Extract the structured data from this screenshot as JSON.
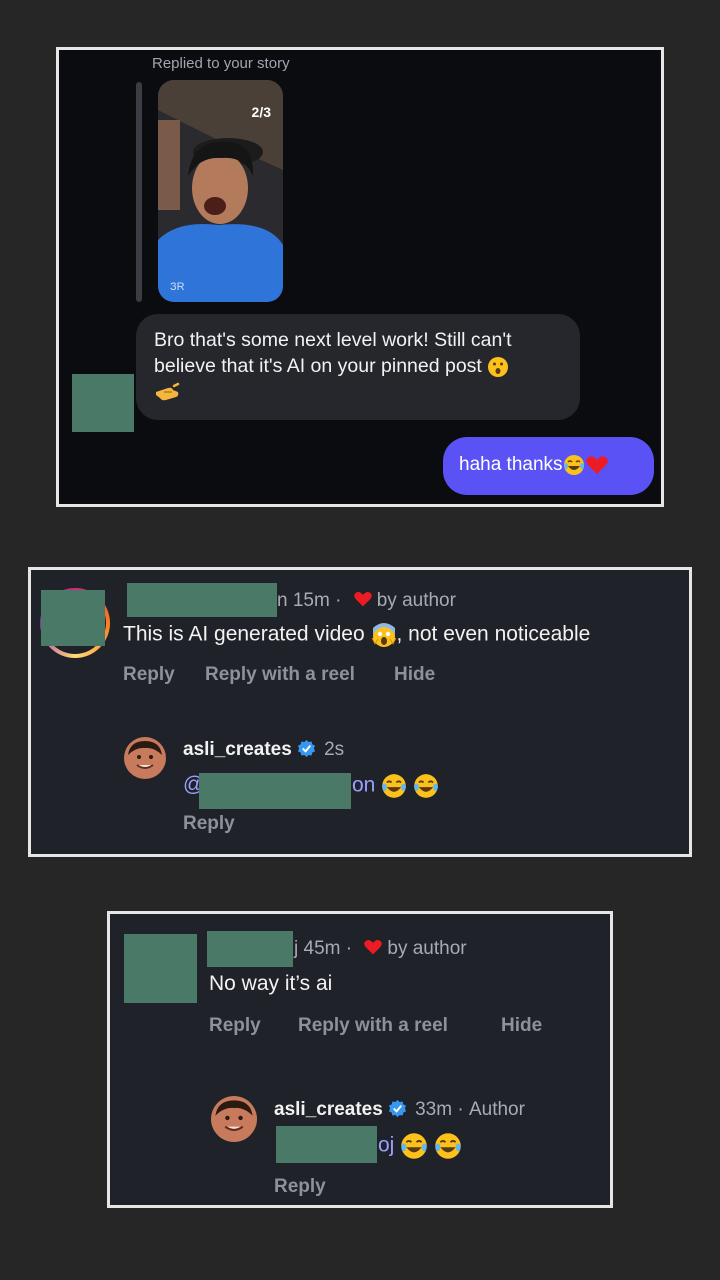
{
  "dm": {
    "replied_label": "Replied to your story",
    "story_counter": "2/3",
    "received_message": "Bro that's some next level work! Still can't believe that it's AI on your pinned post",
    "sent_message": "haha thanks"
  },
  "comment1": {
    "username_suffix": "n",
    "time": "15m",
    "separator": "·",
    "liked_by": "by author",
    "text_before_emoji": "This is AI generated video",
    "text_after_emoji": ", not even noticeable",
    "actions": {
      "reply": "Reply",
      "reply_reel": "Reply with a reel",
      "hide": "Hide"
    },
    "reply": {
      "username": "asli_creates",
      "time": "2s",
      "mention_prefix": "@",
      "mention_suffix": "on",
      "reply_label": "Reply"
    }
  },
  "comment2": {
    "username_suffix": "j",
    "time": "45m",
    "separator": "·",
    "liked_by": "by author",
    "text": "No way it’s ai",
    "actions": {
      "reply": "Reply",
      "reply_reel": "Reply with a reel",
      "hide": "Hide"
    },
    "reply": {
      "username": "asli_creates",
      "time": "33m",
      "separator": "·",
      "author_label": "Author",
      "mention_suffix": "oj",
      "reply_label": "Reply"
    }
  },
  "colors": {
    "background": "#262626",
    "dm_background": "#0b0c10",
    "comment_background": "#1f2228",
    "sent_bubble": "#5b52f5",
    "received_bubble": "#25272d",
    "verified_badge": "#3897f0",
    "heart": "#ed1c24",
    "redaction": "#4a7a67",
    "mention": "#9aa0ff"
  },
  "icons": [
    "surprised-face-emoji",
    "pointing-hand-emoji",
    "tears-of-joy-emoji",
    "red-heart-emoji",
    "screaming-face-emoji",
    "heart-icon",
    "verified-badge-icon"
  ]
}
